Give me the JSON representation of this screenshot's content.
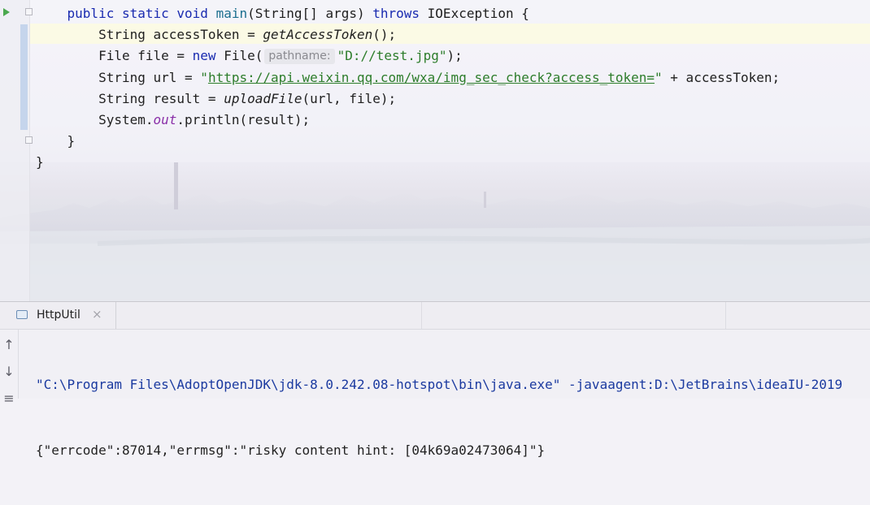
{
  "editor": {
    "lines": [
      {
        "indent": "    ",
        "parts": [
          {
            "t": "public ",
            "c": "kw"
          },
          {
            "t": "static ",
            "c": "kw"
          },
          {
            "t": "void ",
            "c": "kw"
          },
          {
            "t": "main",
            "c": "fn"
          },
          {
            "t": "(String[] args) ",
            "c": ""
          },
          {
            "t": "throws",
            "c": "kw"
          },
          {
            "t": " IOException {",
            "c": ""
          }
        ]
      },
      {
        "indent": "        ",
        "parts": [
          {
            "t": "String accessToken = ",
            "c": ""
          },
          {
            "t": "getAccessToken",
            "c": "it"
          },
          {
            "t": "();",
            "c": ""
          }
        ]
      },
      {
        "indent": "        ",
        "parts": [
          {
            "t": "File file = ",
            "c": ""
          },
          {
            "t": "new",
            "c": "kw"
          },
          {
            "t": " File(",
            "c": ""
          },
          {
            "t": "pathname:",
            "c": "hint"
          },
          {
            "t": "\"D://test.jpg\"",
            "c": "str"
          },
          {
            "t": ");",
            "c": ""
          }
        ]
      },
      {
        "indent": "        ",
        "parts": [
          {
            "t": "String url = ",
            "c": ""
          },
          {
            "t": "\"",
            "c": "str"
          },
          {
            "t": "https://api.weixin.qq.com/wxa/img_sec_check?access_token=",
            "c": "url"
          },
          {
            "t": "\"",
            "c": "str"
          },
          {
            "t": " + accessToken;",
            "c": ""
          }
        ]
      },
      {
        "indent": "        ",
        "parts": [
          {
            "t": "String result = ",
            "c": ""
          },
          {
            "t": "uploadFile",
            "c": "it"
          },
          {
            "t": "(url, file);",
            "c": ""
          }
        ]
      },
      {
        "indent": "        ",
        "parts": [
          {
            "t": "System.",
            "c": ""
          },
          {
            "t": "out",
            "c": "static-field"
          },
          {
            "t": ".println(result);",
            "c": ""
          }
        ]
      },
      {
        "indent": "    ",
        "parts": [
          {
            "t": "}",
            "c": ""
          }
        ]
      },
      {
        "indent": "",
        "parts": [
          {
            "t": "}",
            "c": ""
          }
        ]
      }
    ]
  },
  "run_panel": {
    "tab_label": "HttpUtil",
    "tab_close": "×",
    "side_buttons": [
      "↑",
      "↓",
      "≡"
    ],
    "console": {
      "command": "\"C:\\Program Files\\AdoptOpenJDK\\jdk-8.0.242.08-hotspot\\bin\\java.exe\" -javaagent:D:\\JetBrains\\ideaIU-2019",
      "output": "{\"errcode\":87014,\"errmsg\":\"risky content hint: [04k69a02473064]\"}"
    }
  },
  "colors": {
    "keyword": "#1a2bb0",
    "string": "#2d7d2b",
    "static_field": "#8a2fa8",
    "console_command": "#1b3aa0",
    "run_icon": "#4aa84e"
  }
}
